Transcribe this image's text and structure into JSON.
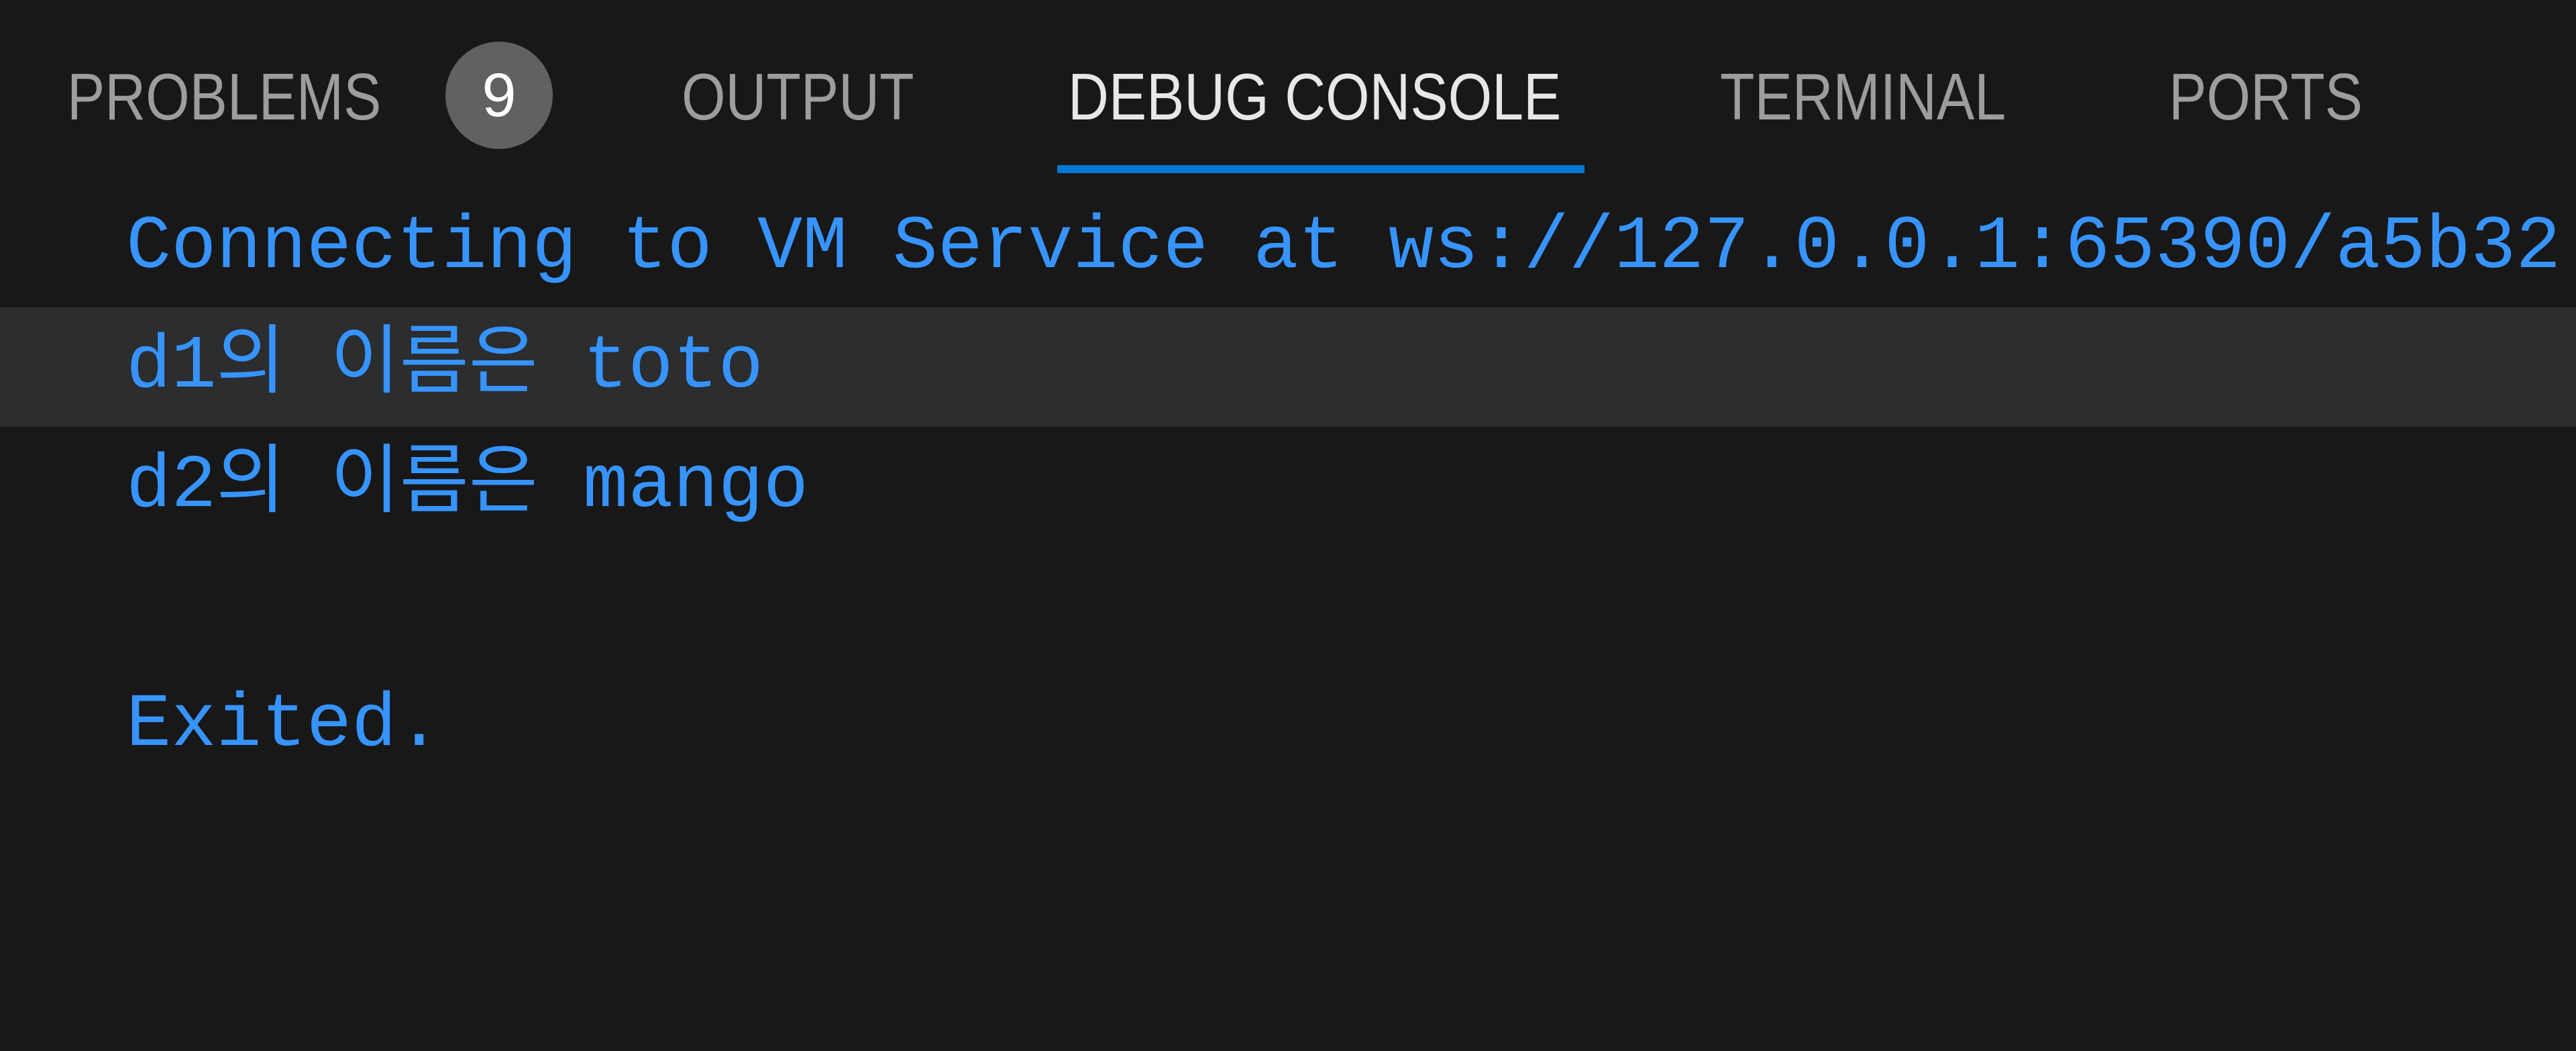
{
  "panel": {
    "tabs": [
      {
        "label": "PROBLEMS",
        "badge": "9",
        "active": false
      },
      {
        "label": "OUTPUT",
        "active": false
      },
      {
        "label": "DEBUG CONSOLE",
        "active": true
      },
      {
        "label": "TERMINAL",
        "active": false
      },
      {
        "label": "PORTS",
        "active": false
      }
    ],
    "colors": {
      "background": "#181818",
      "active_tab_text": "#e7e7e7",
      "inactive_tab_text": "#9d9d9d",
      "active_indicator": "#0078d4",
      "badge_background": "#616161",
      "console_text": "#3794ff",
      "highlight_row": "#2b2d2f"
    }
  },
  "console": {
    "lines": [
      "Connecting to VM Service at ws://127.0.0.1:65390/a5b32",
      "d1의 이름은 toto",
      "d2의 이름은 mango",
      "",
      "Exited."
    ]
  }
}
